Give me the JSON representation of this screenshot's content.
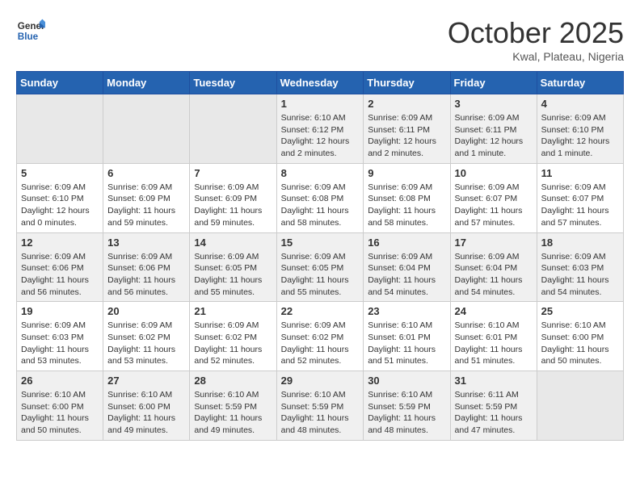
{
  "header": {
    "logo": {
      "general": "General",
      "blue": "Blue"
    },
    "title": "October 2025",
    "location": "Kwal, Plateau, Nigeria"
  },
  "weekdays": [
    "Sunday",
    "Monday",
    "Tuesday",
    "Wednesday",
    "Thursday",
    "Friday",
    "Saturday"
  ],
  "weeks": [
    [
      {
        "day": "",
        "info": ""
      },
      {
        "day": "",
        "info": ""
      },
      {
        "day": "",
        "info": ""
      },
      {
        "day": "1",
        "info": "Sunrise: 6:10 AM\nSunset: 6:12 PM\nDaylight: 12 hours and 2 minutes."
      },
      {
        "day": "2",
        "info": "Sunrise: 6:09 AM\nSunset: 6:11 PM\nDaylight: 12 hours and 2 minutes."
      },
      {
        "day": "3",
        "info": "Sunrise: 6:09 AM\nSunset: 6:11 PM\nDaylight: 12 hours and 1 minute."
      },
      {
        "day": "4",
        "info": "Sunrise: 6:09 AM\nSunset: 6:10 PM\nDaylight: 12 hours and 1 minute."
      }
    ],
    [
      {
        "day": "5",
        "info": "Sunrise: 6:09 AM\nSunset: 6:10 PM\nDaylight: 12 hours and 0 minutes."
      },
      {
        "day": "6",
        "info": "Sunrise: 6:09 AM\nSunset: 6:09 PM\nDaylight: 11 hours and 59 minutes."
      },
      {
        "day": "7",
        "info": "Sunrise: 6:09 AM\nSunset: 6:09 PM\nDaylight: 11 hours and 59 minutes."
      },
      {
        "day": "8",
        "info": "Sunrise: 6:09 AM\nSunset: 6:08 PM\nDaylight: 11 hours and 58 minutes."
      },
      {
        "day": "9",
        "info": "Sunrise: 6:09 AM\nSunset: 6:08 PM\nDaylight: 11 hours and 58 minutes."
      },
      {
        "day": "10",
        "info": "Sunrise: 6:09 AM\nSunset: 6:07 PM\nDaylight: 11 hours and 57 minutes."
      },
      {
        "day": "11",
        "info": "Sunrise: 6:09 AM\nSunset: 6:07 PM\nDaylight: 11 hours and 57 minutes."
      }
    ],
    [
      {
        "day": "12",
        "info": "Sunrise: 6:09 AM\nSunset: 6:06 PM\nDaylight: 11 hours and 56 minutes."
      },
      {
        "day": "13",
        "info": "Sunrise: 6:09 AM\nSunset: 6:06 PM\nDaylight: 11 hours and 56 minutes."
      },
      {
        "day": "14",
        "info": "Sunrise: 6:09 AM\nSunset: 6:05 PM\nDaylight: 11 hours and 55 minutes."
      },
      {
        "day": "15",
        "info": "Sunrise: 6:09 AM\nSunset: 6:05 PM\nDaylight: 11 hours and 55 minutes."
      },
      {
        "day": "16",
        "info": "Sunrise: 6:09 AM\nSunset: 6:04 PM\nDaylight: 11 hours and 54 minutes."
      },
      {
        "day": "17",
        "info": "Sunrise: 6:09 AM\nSunset: 6:04 PM\nDaylight: 11 hours and 54 minutes."
      },
      {
        "day": "18",
        "info": "Sunrise: 6:09 AM\nSunset: 6:03 PM\nDaylight: 11 hours and 54 minutes."
      }
    ],
    [
      {
        "day": "19",
        "info": "Sunrise: 6:09 AM\nSunset: 6:03 PM\nDaylight: 11 hours and 53 minutes."
      },
      {
        "day": "20",
        "info": "Sunrise: 6:09 AM\nSunset: 6:02 PM\nDaylight: 11 hours and 53 minutes."
      },
      {
        "day": "21",
        "info": "Sunrise: 6:09 AM\nSunset: 6:02 PM\nDaylight: 11 hours and 52 minutes."
      },
      {
        "day": "22",
        "info": "Sunrise: 6:09 AM\nSunset: 6:02 PM\nDaylight: 11 hours and 52 minutes."
      },
      {
        "day": "23",
        "info": "Sunrise: 6:10 AM\nSunset: 6:01 PM\nDaylight: 11 hours and 51 minutes."
      },
      {
        "day": "24",
        "info": "Sunrise: 6:10 AM\nSunset: 6:01 PM\nDaylight: 11 hours and 51 minutes."
      },
      {
        "day": "25",
        "info": "Sunrise: 6:10 AM\nSunset: 6:00 PM\nDaylight: 11 hours and 50 minutes."
      }
    ],
    [
      {
        "day": "26",
        "info": "Sunrise: 6:10 AM\nSunset: 6:00 PM\nDaylight: 11 hours and 50 minutes."
      },
      {
        "day": "27",
        "info": "Sunrise: 6:10 AM\nSunset: 6:00 PM\nDaylight: 11 hours and 49 minutes."
      },
      {
        "day": "28",
        "info": "Sunrise: 6:10 AM\nSunset: 5:59 PM\nDaylight: 11 hours and 49 minutes."
      },
      {
        "day": "29",
        "info": "Sunrise: 6:10 AM\nSunset: 5:59 PM\nDaylight: 11 hours and 48 minutes."
      },
      {
        "day": "30",
        "info": "Sunrise: 6:10 AM\nSunset: 5:59 PM\nDaylight: 11 hours and 48 minutes."
      },
      {
        "day": "31",
        "info": "Sunrise: 6:11 AM\nSunset: 5:59 PM\nDaylight: 11 hours and 47 minutes."
      },
      {
        "day": "",
        "info": ""
      }
    ]
  ]
}
